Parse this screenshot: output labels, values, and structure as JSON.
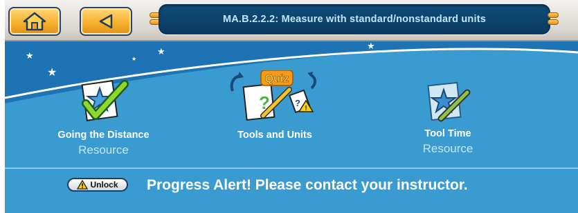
{
  "header": {
    "title": "MA.B.2.2.2: Measure with standard/nonstandard units",
    "home_icon": "home-icon",
    "back_icon": "back-triangle-icon"
  },
  "items": [
    {
      "title": "Going the Distance",
      "subtitle": "Resource",
      "icon": "star-checkmark-icon"
    },
    {
      "title": "Tools and Units",
      "subtitle": "",
      "icon": "quiz-icon",
      "icon_text": "Quiz"
    },
    {
      "title": "Tool Time",
      "subtitle": "Resource",
      "icon": "star-pencil-icon"
    }
  ],
  "footer": {
    "unlock_label": "Unlock",
    "alert": "Progress Alert!  Please contact your instructor."
  },
  "colors": {
    "background": "#3a9bd1",
    "title_bar": "#0f4d7a",
    "title_text": "#bfe6ff",
    "button_orange": "#f7b12d",
    "subtitle": "#bfeaf7"
  }
}
